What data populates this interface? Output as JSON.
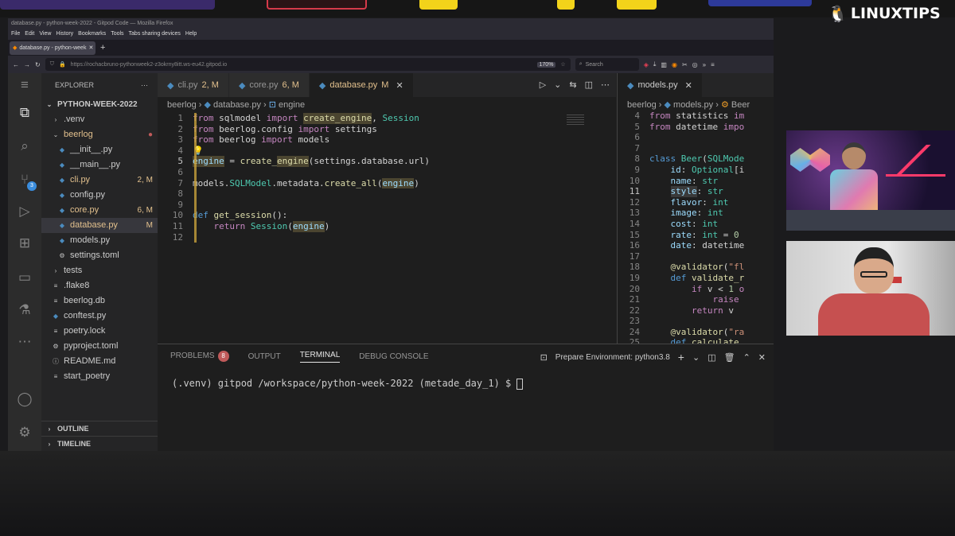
{
  "stream": {
    "brand": "LINUXTIPS"
  },
  "browser": {
    "window_title": "database.py - python-week-2022 - Gitpod Code — Mozilla Firefox",
    "menu": [
      "File",
      "Edit",
      "View",
      "History",
      "Bookmarks",
      "Tools",
      "Tabs sharing devices",
      "Help"
    ],
    "tab_title": "database.py - python-week",
    "url": "https://rochacbruno-pythonweek2-z3okrny8itt.ws-eu42.gitpod.io",
    "zoom": "170%",
    "search_placeholder": "Search"
  },
  "vscode": {
    "explorer_title": "EXPLORER",
    "project": "PYTHON-WEEK-2022",
    "tree": [
      {
        "label": ".venv",
        "type": "folder",
        "depth": 1,
        "status": ""
      },
      {
        "label": "beerlog",
        "type": "folder-open",
        "depth": 1,
        "status": "●"
      },
      {
        "label": "__init__.py",
        "type": "py",
        "depth": 2,
        "status": ""
      },
      {
        "label": "__main__.py",
        "type": "py",
        "depth": 2,
        "status": ""
      },
      {
        "label": "cli.py",
        "type": "py",
        "depth": 2,
        "status": "2, M"
      },
      {
        "label": "config.py",
        "type": "py",
        "depth": 2,
        "status": ""
      },
      {
        "label": "core.py",
        "type": "py",
        "depth": 2,
        "status": "6, M"
      },
      {
        "label": "database.py",
        "type": "py",
        "depth": 2,
        "status": "M"
      },
      {
        "label": "models.py",
        "type": "py",
        "depth": 2,
        "status": ""
      },
      {
        "label": "settings.toml",
        "type": "gear",
        "depth": 2,
        "status": ""
      },
      {
        "label": "tests",
        "type": "folder",
        "depth": 1,
        "status": ""
      },
      {
        "label": ".flake8",
        "type": "file",
        "depth": 1,
        "status": ""
      },
      {
        "label": "beerlog.db",
        "type": "file",
        "depth": 1,
        "status": ""
      },
      {
        "label": "conftest.py",
        "type": "py",
        "depth": 1,
        "status": ""
      },
      {
        "label": "poetry.lock",
        "type": "file",
        "depth": 1,
        "status": ""
      },
      {
        "label": "pyproject.toml",
        "type": "gear",
        "depth": 1,
        "status": ""
      },
      {
        "label": "README.md",
        "type": "info",
        "depth": 1,
        "status": ""
      },
      {
        "label": "start_poetry",
        "type": "file",
        "depth": 1,
        "status": ""
      }
    ],
    "outline": "OUTLINE",
    "timeline": "TIMELINE",
    "scm_badge": "3",
    "tabs": [
      {
        "label": "cli.py",
        "status": "2, M"
      },
      {
        "label": "core.py",
        "status": "6, M"
      },
      {
        "label": "database.py",
        "status": "M"
      }
    ],
    "breadcrumb": [
      "beerlog",
      "database.py",
      "engine"
    ],
    "right_tab": "models.py",
    "right_breadcrumb": [
      "beerlog",
      "models.py",
      "Beer"
    ],
    "panel_tabs": {
      "problems": "PROBLEMS",
      "problems_count": "8",
      "output": "OUTPUT",
      "terminal": "TERMINAL",
      "debug": "DEBUG CONSOLE"
    },
    "terminal_label": "Prepare Environment: python3.8",
    "terminal_prompt": "(.venv) gitpod /workspace/python-week-2022 (metade_day_1) $ "
  }
}
